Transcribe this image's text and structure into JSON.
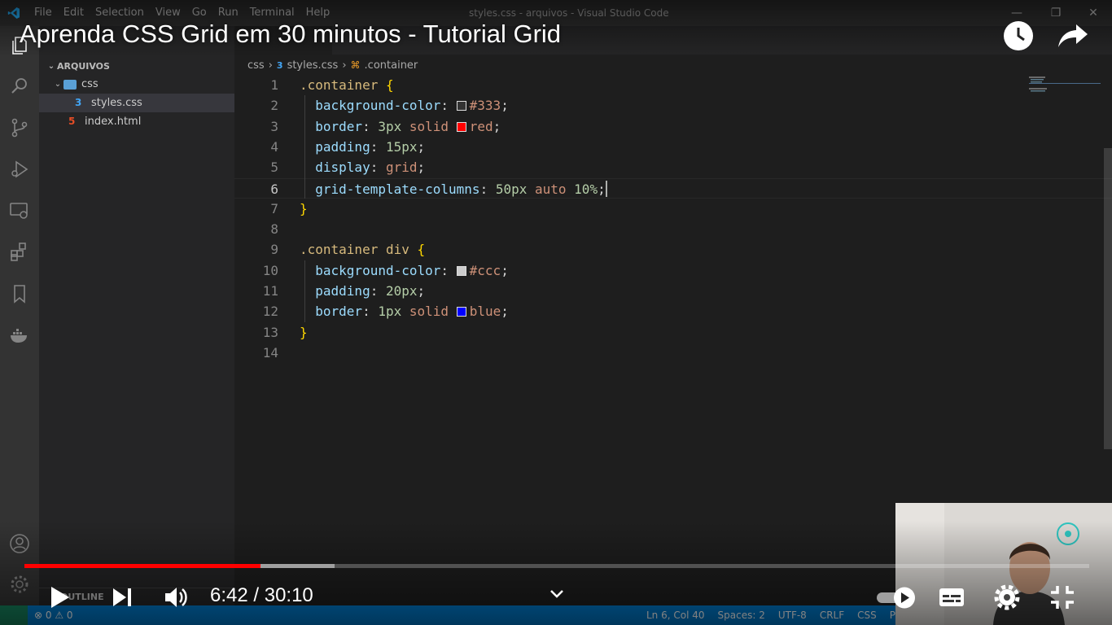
{
  "window": {
    "title": "styles.css - arquivos - Visual Studio Code",
    "menu": [
      "File",
      "Edit",
      "Selection",
      "View",
      "Go",
      "Run",
      "Terminal",
      "Help"
    ]
  },
  "sidebar": {
    "header": "ARQUIVOS",
    "tree": [
      {
        "label": "css",
        "type": "folder",
        "expanded": true
      },
      {
        "label": "styles.css",
        "type": "css-file",
        "active": true
      },
      {
        "label": "index.html",
        "type": "html-file"
      }
    ],
    "outline_label": "OUTLINE"
  },
  "breadcrumb": {
    "items": [
      "css",
      "styles.css",
      ".container"
    ]
  },
  "editor": {
    "current_line": 6,
    "lines": [
      {
        "n": "1",
        "tokens": [
          {
            "t": ".container",
            "c": "sel"
          },
          {
            "t": " ",
            "c": "punc"
          },
          {
            "t": "{",
            "c": "brace"
          }
        ]
      },
      {
        "n": "2",
        "tokens": [
          {
            "t": "  ",
            "c": "punc"
          },
          {
            "t": "background-color",
            "c": "prop"
          },
          {
            "t": ": ",
            "c": "punc"
          },
          {
            "t": "",
            "c": "swatch",
            "color": "#333333"
          },
          {
            "t": "#333",
            "c": "val"
          },
          {
            "t": ";",
            "c": "punc"
          }
        ]
      },
      {
        "n": "3",
        "tokens": [
          {
            "t": "  ",
            "c": "punc"
          },
          {
            "t": "border",
            "c": "prop"
          },
          {
            "t": ": ",
            "c": "punc"
          },
          {
            "t": "3px",
            "c": "num"
          },
          {
            "t": " ",
            "c": "punc"
          },
          {
            "t": "solid",
            "c": "val"
          },
          {
            "t": " ",
            "c": "punc"
          },
          {
            "t": "",
            "c": "swatch",
            "color": "#ff0000"
          },
          {
            "t": "red",
            "c": "val"
          },
          {
            "t": ";",
            "c": "punc"
          }
        ]
      },
      {
        "n": "4",
        "tokens": [
          {
            "t": "  ",
            "c": "punc"
          },
          {
            "t": "padding",
            "c": "prop"
          },
          {
            "t": ": ",
            "c": "punc"
          },
          {
            "t": "15px",
            "c": "num"
          },
          {
            "t": ";",
            "c": "punc"
          }
        ]
      },
      {
        "n": "5",
        "tokens": [
          {
            "t": "  ",
            "c": "punc"
          },
          {
            "t": "display",
            "c": "prop"
          },
          {
            "t": ": ",
            "c": "punc"
          },
          {
            "t": "grid",
            "c": "val"
          },
          {
            "t": ";",
            "c": "punc"
          }
        ]
      },
      {
        "n": "6",
        "tokens": [
          {
            "t": "  ",
            "c": "punc"
          },
          {
            "t": "grid-template-columns",
            "c": "prop"
          },
          {
            "t": ": ",
            "c": "punc"
          },
          {
            "t": "50px",
            "c": "num"
          },
          {
            "t": " ",
            "c": "punc"
          },
          {
            "t": "auto",
            "c": "val"
          },
          {
            "t": " ",
            "c": "punc"
          },
          {
            "t": "10%",
            "c": "num"
          },
          {
            "t": ";",
            "c": "punc"
          },
          {
            "t": "",
            "c": "cursor"
          }
        ]
      },
      {
        "n": "7",
        "tokens": [
          {
            "t": "}",
            "c": "brace"
          }
        ]
      },
      {
        "n": "8",
        "tokens": []
      },
      {
        "n": "9",
        "tokens": [
          {
            "t": ".container div",
            "c": "sel"
          },
          {
            "t": " ",
            "c": "punc"
          },
          {
            "t": "{",
            "c": "brace"
          }
        ]
      },
      {
        "n": "10",
        "tokens": [
          {
            "t": "  ",
            "c": "punc"
          },
          {
            "t": "background-color",
            "c": "prop"
          },
          {
            "t": ": ",
            "c": "punc"
          },
          {
            "t": "",
            "c": "swatch",
            "color": "#cccccc"
          },
          {
            "t": "#ccc",
            "c": "val"
          },
          {
            "t": ";",
            "c": "punc"
          }
        ]
      },
      {
        "n": "11",
        "tokens": [
          {
            "t": "  ",
            "c": "punc"
          },
          {
            "t": "padding",
            "c": "prop"
          },
          {
            "t": ": ",
            "c": "punc"
          },
          {
            "t": "20px",
            "c": "num"
          },
          {
            "t": ";",
            "c": "punc"
          }
        ]
      },
      {
        "n": "12",
        "tokens": [
          {
            "t": "  ",
            "c": "punc"
          },
          {
            "t": "border",
            "c": "prop"
          },
          {
            "t": ": ",
            "c": "punc"
          },
          {
            "t": "1px",
            "c": "num"
          },
          {
            "t": " ",
            "c": "punc"
          },
          {
            "t": "solid",
            "c": "val"
          },
          {
            "t": " ",
            "c": "punc"
          },
          {
            "t": "",
            "c": "swatch",
            "color": "#0000ff"
          },
          {
            "t": "blue",
            "c": "val"
          },
          {
            "t": ";",
            "c": "punc"
          }
        ]
      },
      {
        "n": "13",
        "tokens": [
          {
            "t": "}",
            "c": "brace"
          }
        ]
      },
      {
        "n": "14",
        "tokens": []
      }
    ]
  },
  "statusbar": {
    "problems": "⊗ 0 ⚠ 0",
    "items": [
      "Ln 6, Col 40",
      "Spaces: 2",
      "UTF-8",
      "CRLF",
      "CSS",
      "Port"
    ]
  },
  "video": {
    "title": "Aprenda CSS Grid em 30 minutos - Tutorial Grid",
    "time": "6:42 / 30:10",
    "played_fraction": 0.222,
    "buffered_fraction": 0.291,
    "accent_color": "#ff0000"
  }
}
